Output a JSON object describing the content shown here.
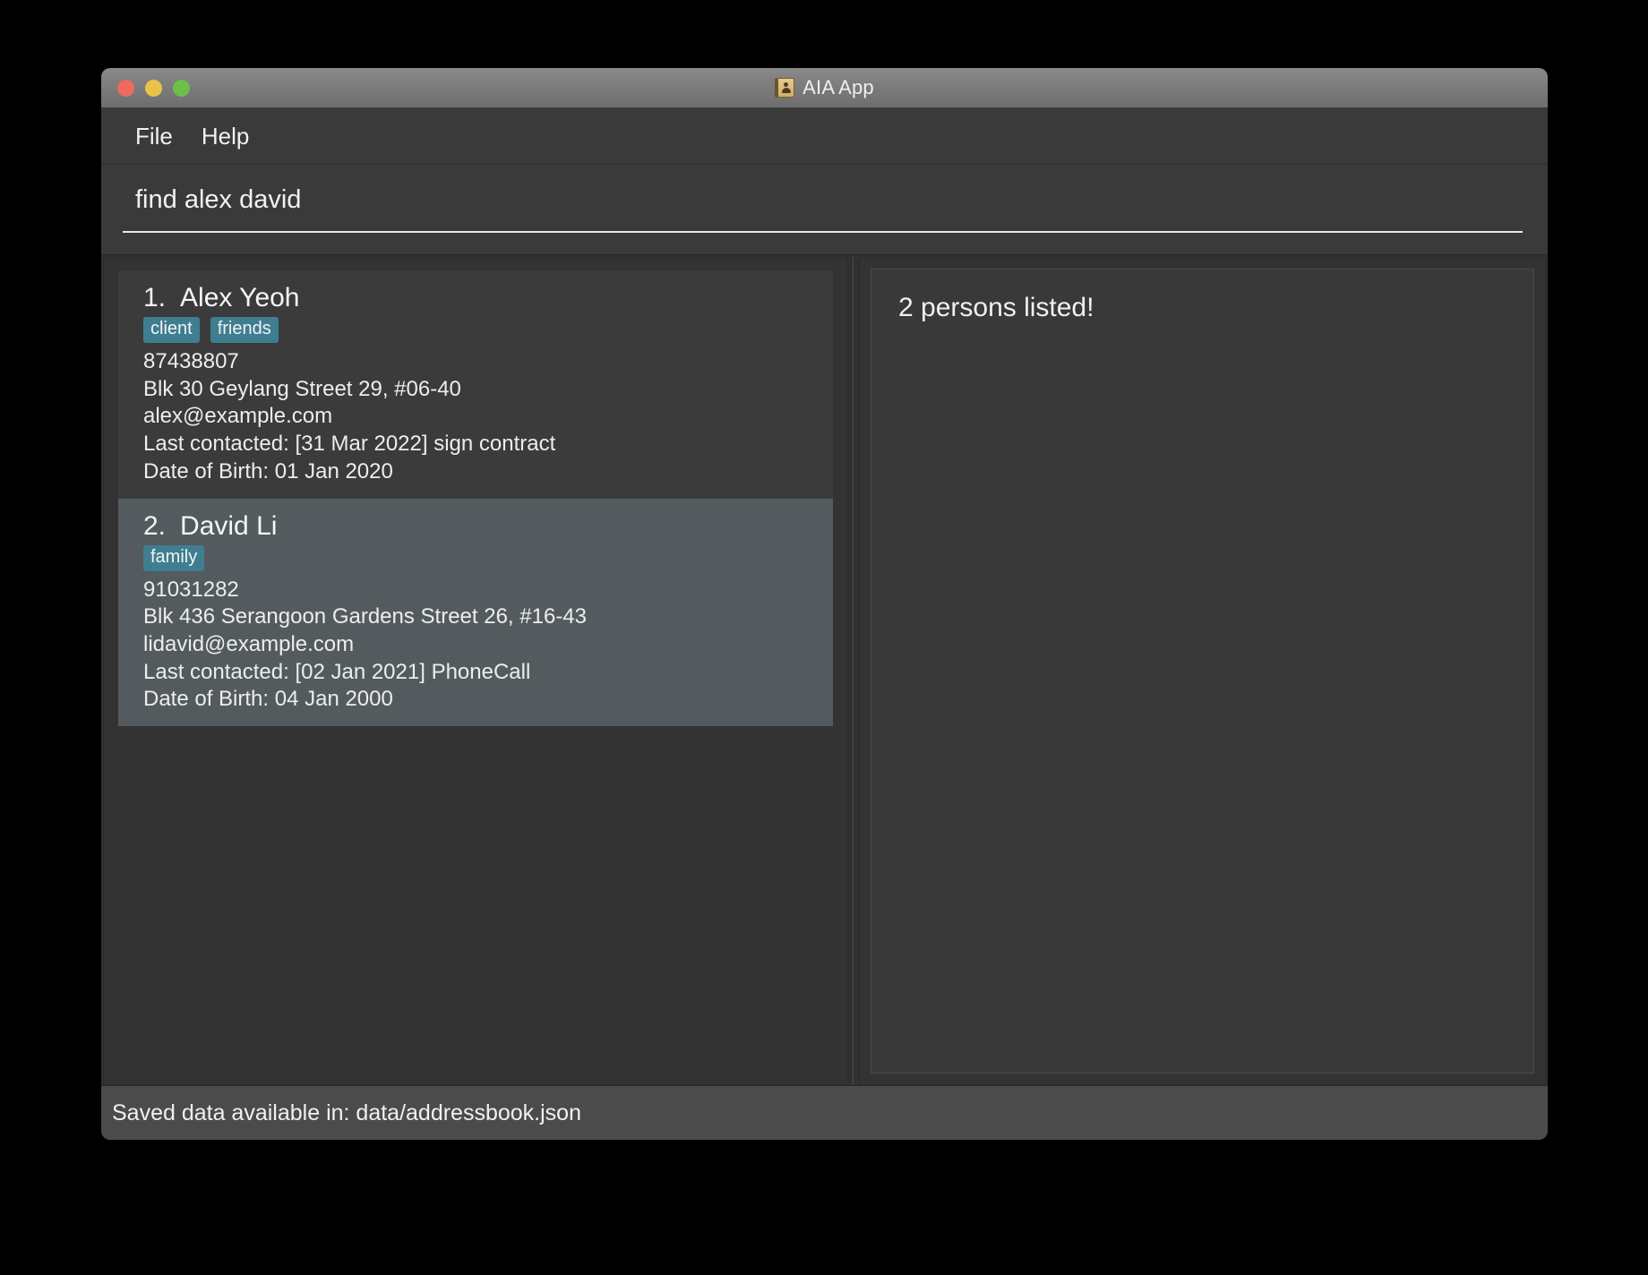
{
  "window": {
    "title": "AIA App",
    "icon": "address-book-icon",
    "traffic_lights": [
      {
        "name": "close",
        "color": "#ee6a5f"
      },
      {
        "name": "minimize",
        "color": "#e9c24a"
      },
      {
        "name": "zoom",
        "color": "#6cc04a"
      }
    ]
  },
  "menubar": {
    "items": [
      {
        "label": "File"
      },
      {
        "label": "Help"
      }
    ]
  },
  "search": {
    "value": "find alex david",
    "placeholder": "Enter command here..."
  },
  "persons": [
    {
      "index": "1.",
      "name": "Alex Yeoh",
      "tags": [
        "client",
        "friends"
      ],
      "phone": "87438807",
      "address": "Blk 30 Geylang Street 29, #06-40",
      "email": "alex@example.com",
      "last_contacted": "Last contacted: [31 Mar 2022] sign contract",
      "date_of_birth": "Date of Birth: 01 Jan 2020",
      "selected": false
    },
    {
      "index": "2.",
      "name": "David Li",
      "tags": [
        "family"
      ],
      "phone": "91031282",
      "address": "Blk 436 Serangoon Gardens Street 26, #16-43",
      "email": "lidavid@example.com",
      "last_contacted": "Last contacted: [02 Jan 2021] PhoneCall",
      "date_of_birth": "Date of Birth: 04 Jan 2000",
      "selected": true
    }
  ],
  "result_panel": {
    "message": "2 persons listed!"
  },
  "statusbar": {
    "text": "Saved data available in: data/addressbook.json"
  },
  "colors": {
    "tag_background": "#3f7e91",
    "selected_card": "#545b5e",
    "card_background": "#3b3b3b",
    "window_background": "#333333",
    "statusbar_background": "#4b4b4b"
  }
}
